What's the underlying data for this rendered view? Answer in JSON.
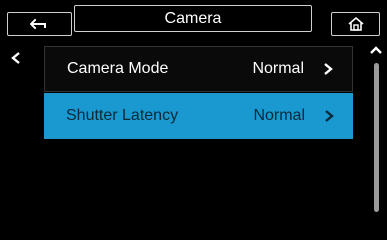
{
  "header": {
    "title": "Camera",
    "back_icon": "back-arrow-icon",
    "home_icon": "home-icon"
  },
  "list": {
    "items": [
      {
        "label": "Camera Mode",
        "value": "Normal",
        "selected": false
      },
      {
        "label": "Shutter Latency",
        "value": "Normal",
        "selected": true
      }
    ]
  },
  "colors": {
    "background": "#000000",
    "selected": "#1a98d0",
    "text": "#ffffff"
  }
}
